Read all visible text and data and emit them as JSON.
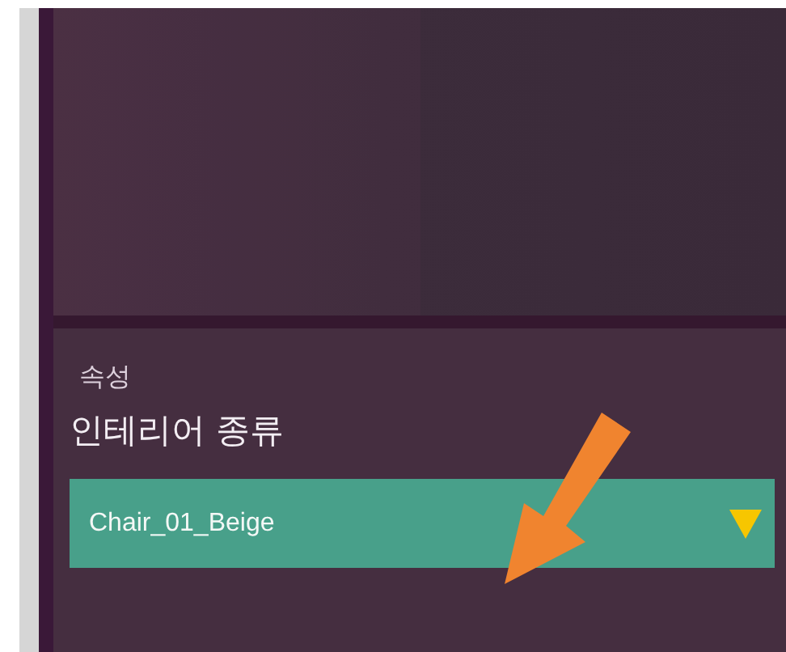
{
  "properties_panel": {
    "title": "속성",
    "field_label": "인테리어 종류",
    "dropdown": {
      "value": "Chair_01_Beige"
    }
  }
}
